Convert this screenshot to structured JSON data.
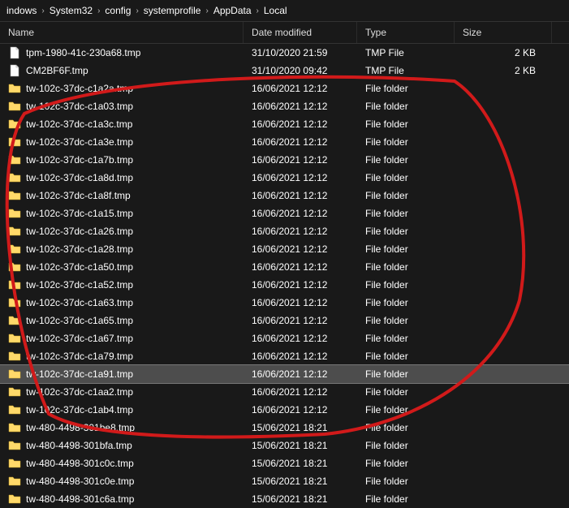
{
  "breadcrumb": [
    "indows",
    "System32",
    "config",
    "systemprofile",
    "AppData",
    "Local"
  ],
  "columns": {
    "name": "Name",
    "date": "Date modified",
    "type": "Type",
    "size": "Size"
  },
  "selected_index": 18,
  "rows": [
    {
      "name": "tpm-1980-41c-230a68.tmp",
      "date": "31/10/2020 21:59",
      "type": "TMP File",
      "size": "2 KB",
      "icon": "file"
    },
    {
      "name": "CM2BF6F.tmp",
      "date": "31/10/2020 09:42",
      "type": "TMP File",
      "size": "2 KB",
      "icon": "file"
    },
    {
      "name": "tw-102c-37dc-c1a2a.tmp",
      "date": "16/06/2021 12:12",
      "type": "File folder",
      "size": "",
      "icon": "folder"
    },
    {
      "name": "tw-102c-37dc-c1a03.tmp",
      "date": "16/06/2021 12:12",
      "type": "File folder",
      "size": "",
      "icon": "folder"
    },
    {
      "name": "tw-102c-37dc-c1a3c.tmp",
      "date": "16/06/2021 12:12",
      "type": "File folder",
      "size": "",
      "icon": "folder"
    },
    {
      "name": "tw-102c-37dc-c1a3e.tmp",
      "date": "16/06/2021 12:12",
      "type": "File folder",
      "size": "",
      "icon": "folder"
    },
    {
      "name": "tw-102c-37dc-c1a7b.tmp",
      "date": "16/06/2021 12:12",
      "type": "File folder",
      "size": "",
      "icon": "folder"
    },
    {
      "name": "tw-102c-37dc-c1a8d.tmp",
      "date": "16/06/2021 12:12",
      "type": "File folder",
      "size": "",
      "icon": "folder"
    },
    {
      "name": "tw-102c-37dc-c1a8f.tmp",
      "date": "16/06/2021 12:12",
      "type": "File folder",
      "size": "",
      "icon": "folder"
    },
    {
      "name": "tw-102c-37dc-c1a15.tmp",
      "date": "16/06/2021 12:12",
      "type": "File folder",
      "size": "",
      "icon": "folder"
    },
    {
      "name": "tw-102c-37dc-c1a26.tmp",
      "date": "16/06/2021 12:12",
      "type": "File folder",
      "size": "",
      "icon": "folder"
    },
    {
      "name": "tw-102c-37dc-c1a28.tmp",
      "date": "16/06/2021 12:12",
      "type": "File folder",
      "size": "",
      "icon": "folder"
    },
    {
      "name": "tw-102c-37dc-c1a50.tmp",
      "date": "16/06/2021 12:12",
      "type": "File folder",
      "size": "",
      "icon": "folder"
    },
    {
      "name": "tw-102c-37dc-c1a52.tmp",
      "date": "16/06/2021 12:12",
      "type": "File folder",
      "size": "",
      "icon": "folder"
    },
    {
      "name": "tw-102c-37dc-c1a63.tmp",
      "date": "16/06/2021 12:12",
      "type": "File folder",
      "size": "",
      "icon": "folder"
    },
    {
      "name": "tw-102c-37dc-c1a65.tmp",
      "date": "16/06/2021 12:12",
      "type": "File folder",
      "size": "",
      "icon": "folder"
    },
    {
      "name": "tw-102c-37dc-c1a67.tmp",
      "date": "16/06/2021 12:12",
      "type": "File folder",
      "size": "",
      "icon": "folder"
    },
    {
      "name": "tw-102c-37dc-c1a79.tmp",
      "date": "16/06/2021 12:12",
      "type": "File folder",
      "size": "",
      "icon": "folder"
    },
    {
      "name": "tw-102c-37dc-c1a91.tmp",
      "date": "16/06/2021 12:12",
      "type": "File folder",
      "size": "",
      "icon": "folder"
    },
    {
      "name": "tw-102c-37dc-c1aa2.tmp",
      "date": "16/06/2021 12:12",
      "type": "File folder",
      "size": "",
      "icon": "folder"
    },
    {
      "name": "tw-102c-37dc-c1ab4.tmp",
      "date": "16/06/2021 12:12",
      "type": "File folder",
      "size": "",
      "icon": "folder"
    },
    {
      "name": "tw-480-4498-301be8.tmp",
      "date": "15/06/2021 18:21",
      "type": "File folder",
      "size": "",
      "icon": "folder"
    },
    {
      "name": "tw-480-4498-301bfa.tmp",
      "date": "15/06/2021 18:21",
      "type": "File folder",
      "size": "",
      "icon": "folder"
    },
    {
      "name": "tw-480-4498-301c0c.tmp",
      "date": "15/06/2021 18:21",
      "type": "File folder",
      "size": "",
      "icon": "folder"
    },
    {
      "name": "tw-480-4498-301c0e.tmp",
      "date": "15/06/2021 18:21",
      "type": "File folder",
      "size": "",
      "icon": "folder"
    },
    {
      "name": "tw-480-4498-301c6a.tmp",
      "date": "15/06/2021 18:21",
      "type": "File folder",
      "size": "",
      "icon": "folder"
    }
  ]
}
